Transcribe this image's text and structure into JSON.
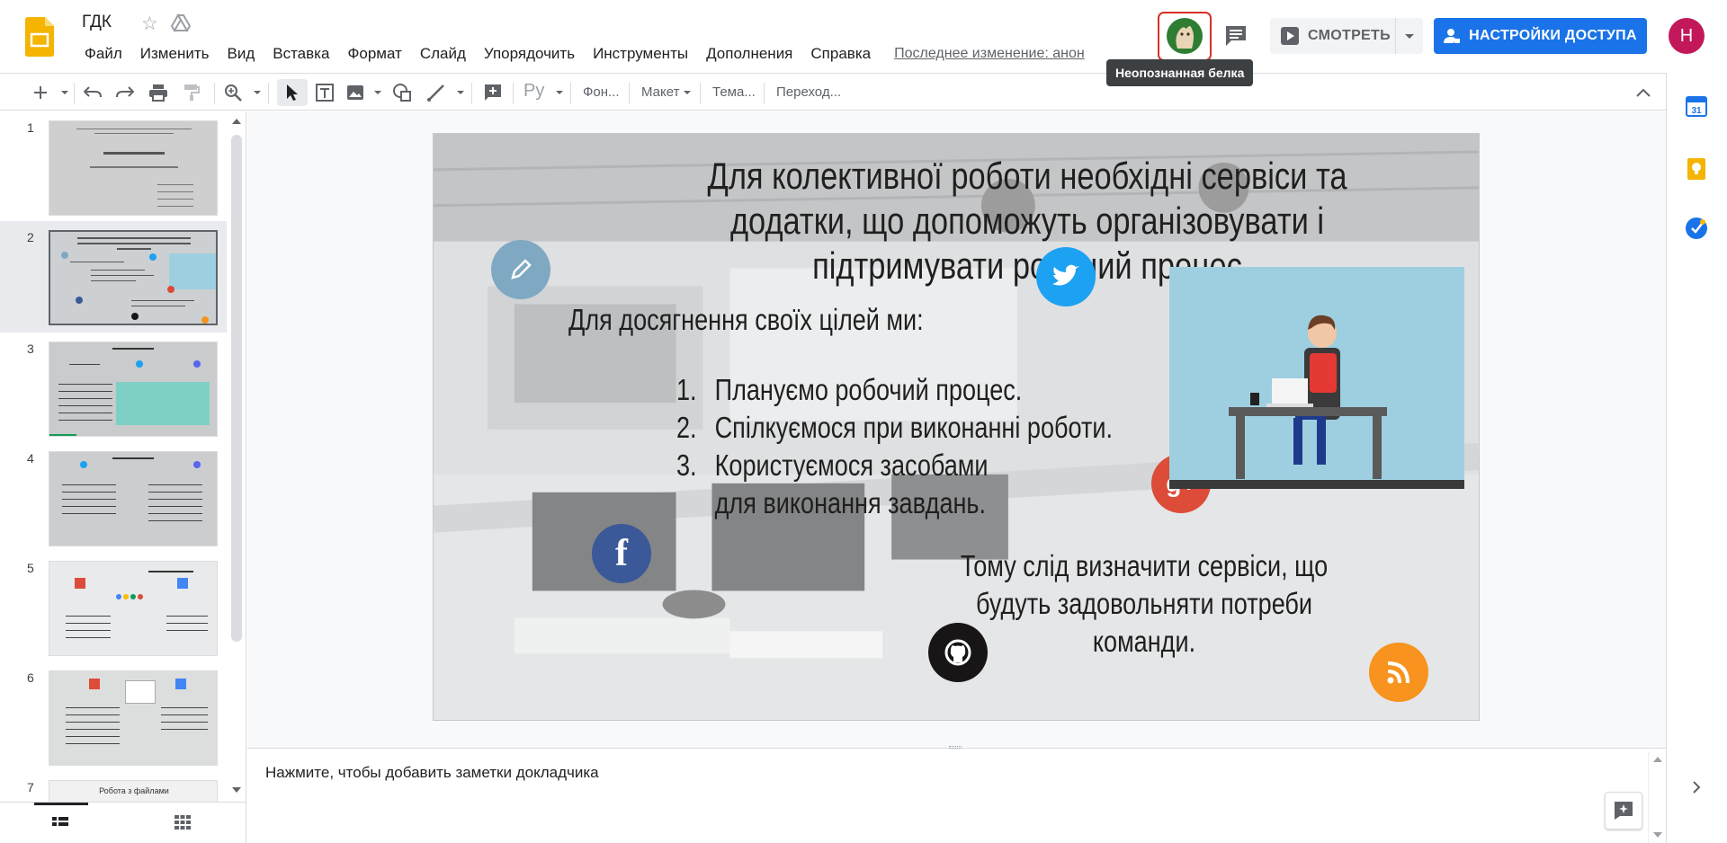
{
  "header": {
    "doc_title": "ГДК",
    "menu": [
      "Файл",
      "Изменить",
      "Вид",
      "Вставка",
      "Формат",
      "Слайд",
      "Упорядочить",
      "Инструменты",
      "Дополнения",
      "Справка"
    ],
    "last_edit": "Последнее изменение: анон",
    "collaborator_tooltip": "Неопознанная белка",
    "present_label": "СМОТРЕТЬ",
    "share_label": "НАСТРОЙКИ ДОСТУПА",
    "account_initial": "Н"
  },
  "toolbar": {
    "font_label": "Ру",
    "background_label": "Фон...",
    "layout_label": "Макет",
    "theme_label": "Тема...",
    "transition_label": "Переход..."
  },
  "filmstrip": {
    "slides": [
      {
        "num": "1"
      },
      {
        "num": "2"
      },
      {
        "num": "3"
      },
      {
        "num": "4"
      },
      {
        "num": "5"
      },
      {
        "num": "6"
      },
      {
        "num": "7"
      }
    ],
    "selected": 2,
    "slide7_label": "Робота з файлами"
  },
  "slide": {
    "title": "Для колективної роботи необхідні сервіси та додатки, що допоможуть організовувати і підтримувати робочий процес",
    "intro": "Для досягнення своїх цілей ми:",
    "list": [
      {
        "num": "1.",
        "text": "Плануємо робочий процес."
      },
      {
        "num": "2.",
        "text": "Спілкуємося при виконанні роботи."
      },
      {
        "num": "3.",
        "text": "Користуємося засобами для виконання завдань."
      }
    ],
    "conclusion": "Тому слід визначити сервіси, що будуть задовольняти потреби команди."
  },
  "notes": {
    "placeholder": "Нажмите, чтобы добавить заметки докладчика"
  },
  "colors": {
    "share_blue": "#1a73e8",
    "twitter": "#1da1f2",
    "facebook": "#3b5998",
    "google_plus": "#dd4b39",
    "github": "#171515",
    "rss": "#f7931e",
    "pencil": "#7fa9c2"
  }
}
